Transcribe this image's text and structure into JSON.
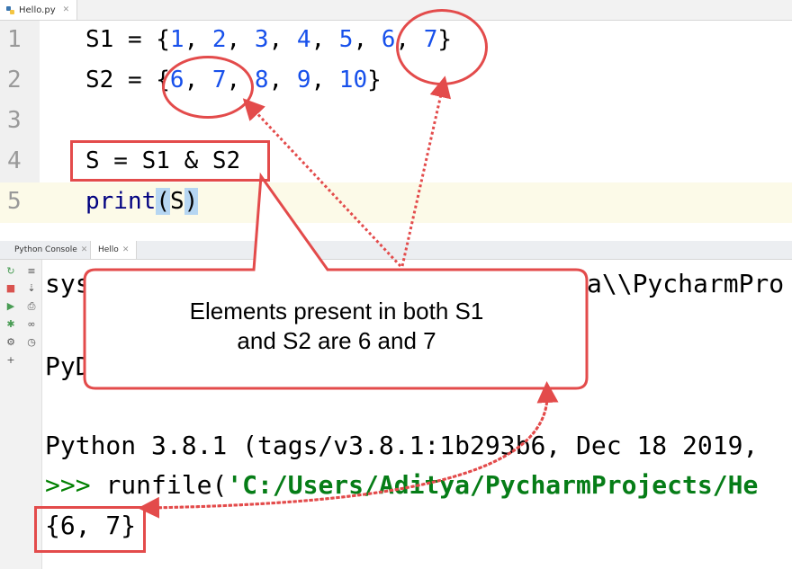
{
  "editor": {
    "tab_label": "Hello.py",
    "lines": [
      {
        "num": "1",
        "text": "S1 = {1, 2, 3, 4, 5, 6, 7}"
      },
      {
        "num": "2",
        "text": "S2 = {6, 7, 8, 9, 10}"
      },
      {
        "num": "3",
        "text": ""
      },
      {
        "num": "4",
        "text": "S = S1 & S2"
      },
      {
        "num": "5",
        "text": "print(S)"
      }
    ]
  },
  "console": {
    "tabs": [
      "Python Console",
      "Hello"
    ],
    "lines": {
      "sys_fragment": "sys",
      "path_fragment": "a\\\\PycharmPro",
      "pyd_fragment": "PyD",
      "version": "Python 3.8.1 (tags/v3.8.1:1b293b6, Dec 18 2019,",
      "prompt": ">>>",
      "runfile_call": "runfile(",
      "runfile_arg": "'C:/Users/Aditya/PycharmProjects/He",
      "output": "{6, 7}"
    }
  },
  "annotation": {
    "callout_line1": "Elements present in both S1",
    "callout_line2": "and S2 are 6 and 7",
    "accent_color": "#e34b4b"
  }
}
